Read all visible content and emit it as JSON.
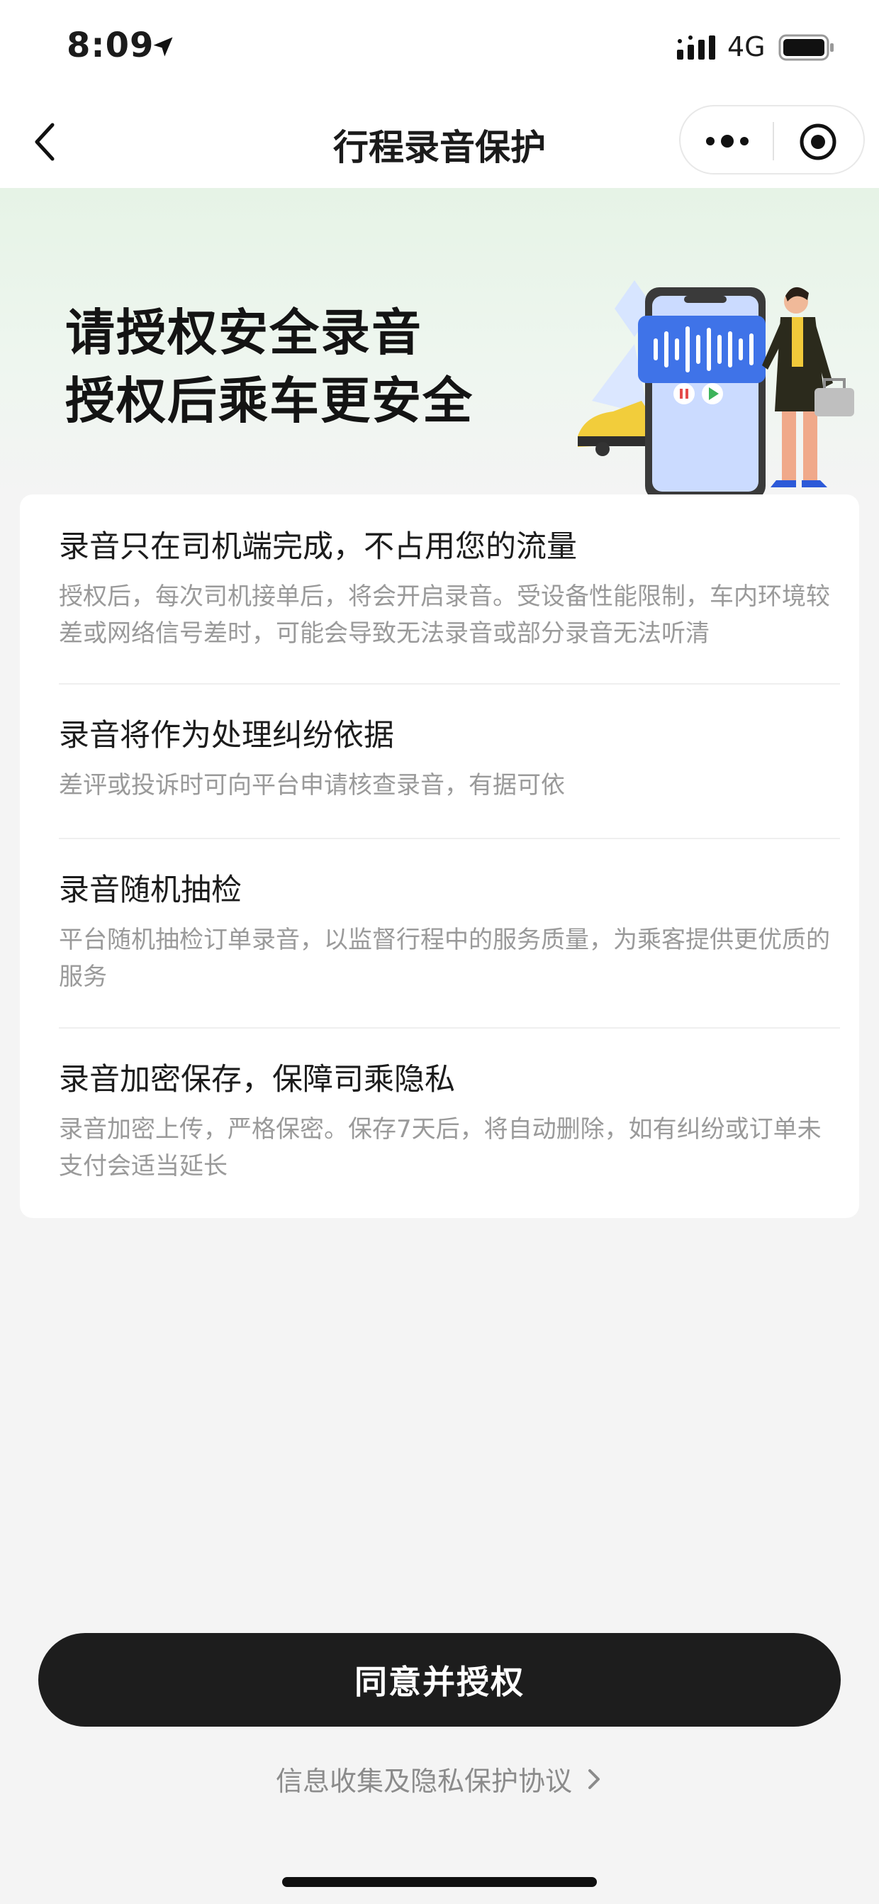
{
  "status_bar": {
    "time": "8:09",
    "network": "4G"
  },
  "nav": {
    "title": "行程录音保护"
  },
  "hero": {
    "line1": "请授权安全录音",
    "line2": "授权后乘车更安全"
  },
  "items": [
    {
      "title": "录音只在司机端完成，不占用您的流量",
      "desc": "授权后，每次司机接单后，将会开启录音。受设备性能限制，车内环境较差或网络信号差时，可能会导致无法录音或部分录音无法听清"
    },
    {
      "title": "录音将作为处理纠纷依据",
      "desc": "差评或投诉时可向平台申请核查录音，有据可依"
    },
    {
      "title": "录音随机抽检",
      "desc": "平台随机抽检订单录音，以监督行程中的服务质量，为乘客提供更优质的服务"
    },
    {
      "title": "录音加密保存，保障司乘隐私",
      "desc": "录音加密上传，严格保密。保存7天后，将自动删除，如有纠纷或订单未支付会适当延长"
    }
  ],
  "actions": {
    "agree_label": "同意并授权",
    "privacy_label": "信息收集及隐私保护协议"
  },
  "icons": [
    "location-arrow-icon",
    "signal-icon",
    "battery-icon",
    "back-icon",
    "more-icon",
    "target-icon",
    "chevron-right-icon"
  ],
  "colors": {
    "button": "#1d1d1d",
    "hero_tint": "#e6f3e6",
    "accent_blue": "#3f73e8"
  }
}
